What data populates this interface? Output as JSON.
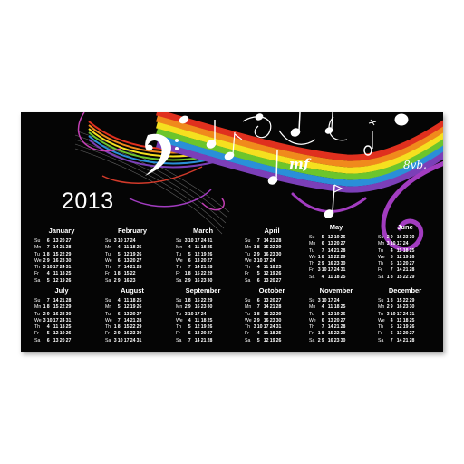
{
  "calendar": {
    "year": "2013",
    "day_abbr": [
      "Su",
      "Mn",
      "Tu",
      "We",
      "Th",
      "Fr",
      "Sa"
    ],
    "months": [
      {
        "name": "January",
        "rows": [
          [
            "6",
            "13",
            "20",
            "27"
          ],
          [
            "7",
            "14",
            "21",
            "28"
          ],
          [
            "1",
            "8",
            "15",
            "22",
            "29"
          ],
          [
            "2",
            "9",
            "16",
            "23",
            "30"
          ],
          [
            "3",
            "10",
            "17",
            "24",
            "31"
          ],
          [
            "4",
            "11",
            "18",
            "25"
          ],
          [
            "5",
            "12",
            "19",
            "26"
          ]
        ]
      },
      {
        "name": "February",
        "rows": [
          [
            "3",
            "10",
            "17",
            "24"
          ],
          [
            "4",
            "11",
            "18",
            "25"
          ],
          [
            "5",
            "12",
            "19",
            "26"
          ],
          [
            "6",
            "13",
            "20",
            "27"
          ],
          [
            "7",
            "14",
            "21",
            "28"
          ],
          [
            "1",
            "8",
            "15",
            "22"
          ],
          [
            "2",
            "9",
            "16",
            "23"
          ]
        ]
      },
      {
        "name": "March",
        "rows": [
          [
            "3",
            "10",
            "17",
            "24",
            "31"
          ],
          [
            "4",
            "11",
            "18",
            "25"
          ],
          [
            "5",
            "12",
            "19",
            "26"
          ],
          [
            "6",
            "13",
            "20",
            "27"
          ],
          [
            "7",
            "14",
            "21",
            "28"
          ],
          [
            "1",
            "8",
            "15",
            "22",
            "29"
          ],
          [
            "2",
            "9",
            "16",
            "23",
            "30"
          ]
        ]
      },
      {
        "name": "April",
        "rows": [
          [
            "7",
            "14",
            "21",
            "28"
          ],
          [
            "1",
            "8",
            "15",
            "22",
            "29"
          ],
          [
            "2",
            "9",
            "16",
            "23",
            "30"
          ],
          [
            "3",
            "10",
            "17",
            "24"
          ],
          [
            "4",
            "11",
            "18",
            "25"
          ],
          [
            "5",
            "12",
            "19",
            "26"
          ],
          [
            "6",
            "13",
            "20",
            "27"
          ]
        ]
      },
      {
        "name": "May",
        "rows": [
          [
            "5",
            "12",
            "19",
            "26"
          ],
          [
            "6",
            "13",
            "20",
            "27"
          ],
          [
            "7",
            "14",
            "21",
            "28"
          ],
          [
            "1",
            "8",
            "15",
            "22",
            "29"
          ],
          [
            "2",
            "9",
            "16",
            "23",
            "30"
          ],
          [
            "3",
            "10",
            "17",
            "24",
            "31"
          ],
          [
            "4",
            "11",
            "18",
            "25"
          ]
        ]
      },
      {
        "name": "June",
        "rows": [
          [
            "2",
            "9",
            "16",
            "23",
            "30"
          ],
          [
            "3",
            "10",
            "17",
            "24"
          ],
          [
            "4",
            "11",
            "18",
            "25"
          ],
          [
            "5",
            "12",
            "19",
            "26"
          ],
          [
            "6",
            "13",
            "20",
            "27"
          ],
          [
            "7",
            "14",
            "21",
            "28"
          ],
          [
            "1",
            "8",
            "15",
            "22",
            "29"
          ]
        ]
      },
      {
        "name": "July",
        "rows": [
          [
            "7",
            "14",
            "21",
            "28"
          ],
          [
            "1",
            "8",
            "15",
            "22",
            "29"
          ],
          [
            "2",
            "9",
            "16",
            "23",
            "30"
          ],
          [
            "3",
            "10",
            "17",
            "24",
            "31"
          ],
          [
            "4",
            "11",
            "18",
            "25"
          ],
          [
            "5",
            "12",
            "19",
            "26"
          ],
          [
            "6",
            "13",
            "20",
            "27"
          ]
        ]
      },
      {
        "name": "August",
        "rows": [
          [
            "4",
            "11",
            "18",
            "25"
          ],
          [
            "5",
            "12",
            "19",
            "26"
          ],
          [
            "6",
            "13",
            "20",
            "27"
          ],
          [
            "7",
            "14",
            "21",
            "28"
          ],
          [
            "1",
            "8",
            "15",
            "22",
            "29"
          ],
          [
            "2",
            "9",
            "16",
            "23",
            "30"
          ],
          [
            "3",
            "10",
            "17",
            "24",
            "31"
          ]
        ]
      },
      {
        "name": "September",
        "rows": [
          [
            "1",
            "8",
            "15",
            "22",
            "29"
          ],
          [
            "2",
            "9",
            "16",
            "23",
            "30"
          ],
          [
            "3",
            "10",
            "17",
            "24"
          ],
          [
            "4",
            "11",
            "18",
            "25"
          ],
          [
            "5",
            "12",
            "19",
            "26"
          ],
          [
            "6",
            "13",
            "20",
            "27"
          ],
          [
            "7",
            "14",
            "21",
            "28"
          ]
        ]
      },
      {
        "name": "October",
        "rows": [
          [
            "6",
            "13",
            "20",
            "27"
          ],
          [
            "7",
            "14",
            "21",
            "28"
          ],
          [
            "1",
            "8",
            "15",
            "22",
            "29"
          ],
          [
            "2",
            "9",
            "16",
            "23",
            "30"
          ],
          [
            "3",
            "10",
            "17",
            "24",
            "31"
          ],
          [
            "4",
            "11",
            "18",
            "25"
          ],
          [
            "5",
            "12",
            "19",
            "26"
          ]
        ]
      },
      {
        "name": "November",
        "rows": [
          [
            "3",
            "10",
            "17",
            "24"
          ],
          [
            "4",
            "11",
            "18",
            "25"
          ],
          [
            "5",
            "12",
            "19",
            "26"
          ],
          [
            "6",
            "13",
            "20",
            "27"
          ],
          [
            "7",
            "14",
            "21",
            "28"
          ],
          [
            "1",
            "8",
            "15",
            "22",
            "29"
          ],
          [
            "2",
            "9",
            "16",
            "23",
            "30"
          ]
        ]
      },
      {
        "name": "December",
        "rows": [
          [
            "1",
            "8",
            "15",
            "22",
            "29"
          ],
          [
            "2",
            "9",
            "16",
            "23",
            "30"
          ],
          [
            "3",
            "10",
            "17",
            "24",
            "31"
          ],
          [
            "4",
            "11",
            "18",
            "25"
          ],
          [
            "5",
            "12",
            "19",
            "26"
          ],
          [
            "6",
            "13",
            "20",
            "27"
          ],
          [
            "7",
            "14",
            "21",
            "28"
          ]
        ]
      }
    ]
  },
  "artwork": {
    "dynamic_mark": "mf",
    "tempo_mark": "8vb.",
    "rainbow_colors": [
      "#e0301e",
      "#f08a1c",
      "#f5e01f",
      "#6cc52c",
      "#2a8fd8",
      "#7b3fb8",
      "#c23fb4"
    ],
    "swirl_color": "#a23cc0",
    "background_color": "#050505",
    "icons": [
      "bass-clef-icon",
      "treble-clef-icon",
      "music-note-icon"
    ]
  }
}
